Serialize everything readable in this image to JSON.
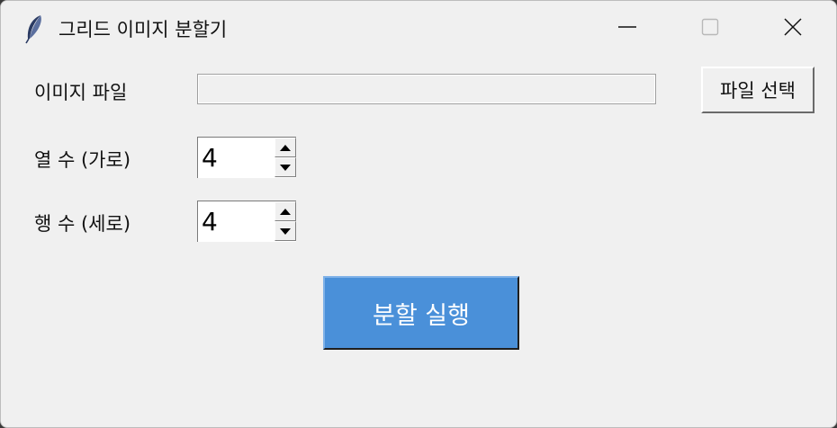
{
  "window": {
    "title": "그리드 이미지 분할기",
    "icon": "feather-icon"
  },
  "form": {
    "file_label": "이미지 파일",
    "file_value": "",
    "file_button_label": "파일 선택",
    "cols_label": "열 수 (가로)",
    "cols_value": "4",
    "rows_label": "행 수 (세로)",
    "rows_value": "4",
    "run_button_label": "분할 실행"
  },
  "colors": {
    "window_bg": "#f0f0f0",
    "run_button_bg": "#4a90d9",
    "run_button_text": "#ffffff"
  }
}
